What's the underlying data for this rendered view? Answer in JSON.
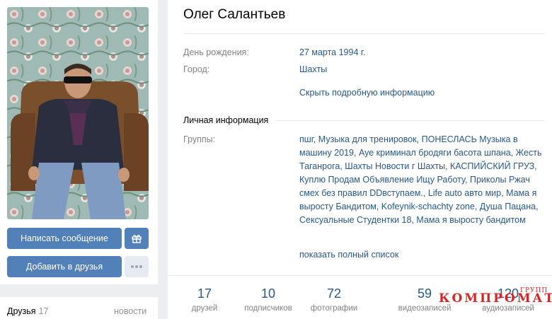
{
  "profile": {
    "name": "Олег Салантьев",
    "info": {
      "birthday_label": "День рождения:",
      "birthday_value": "27 марта 1994 г.",
      "city_label": "Город:",
      "city_value": "Шахты",
      "hide_details_link": "Скрыть подробную информацию"
    },
    "personal_section_title": "Личная информация",
    "groups_label": "Группы:",
    "groups": [
      "пшг",
      "Музыка для тренировок",
      "ПОНЕСЛАСЬ Музыка в машину 2019",
      "Ауе криминал бродяги басота шпана",
      "Жесть Таганрога",
      "Шахты Новости г Шахты",
      "КАСПИЙСКИЙ ГРУЗ",
      "Куплю Продам Объявление Ищу Работу",
      "Приколы Ржач смех без правил DDвступаем.",
      "Life auto авто мир",
      "Мама я выросту Бандитом",
      "Kofeynik-schachty zone",
      "Душа Пацана",
      "Сексуальные Студентки 18",
      "Мама я выросту бандитом"
    ],
    "show_full_list": "показать полный список"
  },
  "actions": {
    "message_button": "Написать сообщение",
    "gift_icon": "gift-icon",
    "add_friend_button": "Добавить в друзья",
    "more_icon": "more-dots-icon"
  },
  "counters": [
    {
      "value": "17",
      "label": "друзей"
    },
    {
      "value": "10",
      "label": "подписчиков"
    },
    {
      "value": "72",
      "label": "фотографии"
    },
    {
      "value": "59",
      "label": "видеозаписей"
    },
    {
      "value": "120",
      "label": "аудиозаписей"
    }
  ],
  "friends_block": {
    "title": "Друзья",
    "count": "17",
    "news_link": "новости"
  },
  "watermark": {
    "text": "КОМПРОМАТ",
    "small": "ГРУПП"
  },
  "colors": {
    "accent": "#5181b8",
    "link": "#2a5885",
    "label_gray": "#828282",
    "background": "#edeef0",
    "watermark": "#d42424"
  }
}
